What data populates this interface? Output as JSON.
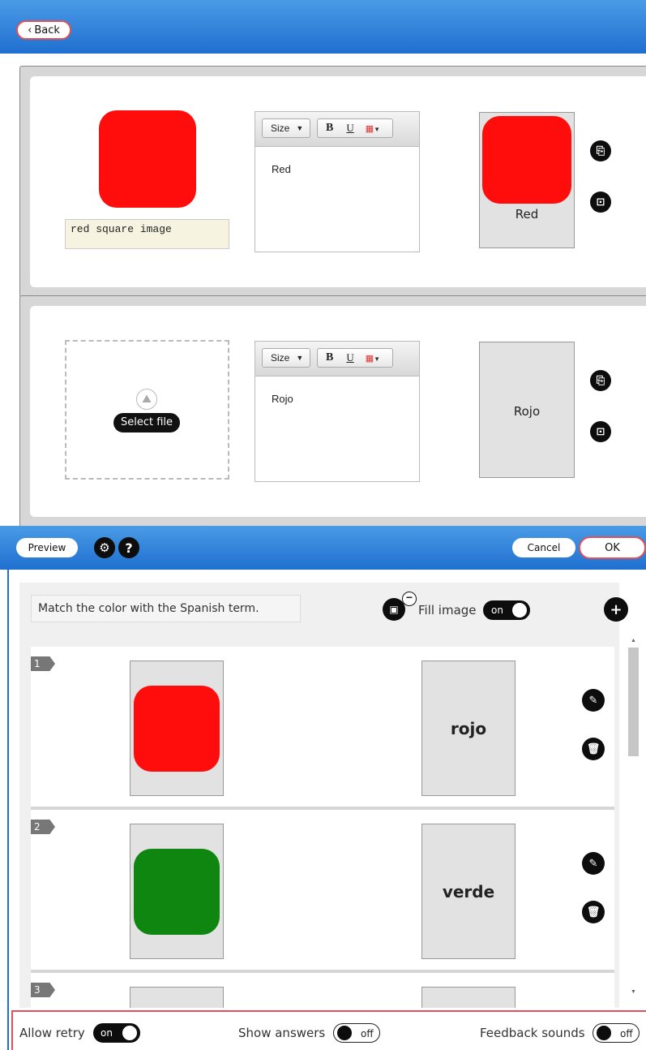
{
  "top": {
    "back_label": "Back"
  },
  "card1": {
    "alt_text": "red square image",
    "editor_text": "Red",
    "preview_label": "Red",
    "toolbar": {
      "size_label": "Size",
      "bold": "B",
      "underline": "U"
    }
  },
  "card2": {
    "select_file_label": "Select file",
    "editor_text": "Rojo",
    "preview_label": "Rojo",
    "toolbar": {
      "size_label": "Size",
      "bold": "B",
      "underline": "U"
    }
  },
  "toolbar": {
    "preview_label": "Preview",
    "help_symbol": "?",
    "cancel_label": "Cancel",
    "ok_label": "OK"
  },
  "instructions": "Match the color with the Spanish term.",
  "fill_image": {
    "label": "Fill image",
    "state": "on"
  },
  "items": [
    {
      "number": "1",
      "term": "rojo",
      "color": "#ff0d0d"
    },
    {
      "number": "2",
      "term": "verde",
      "color": "#0f860f"
    },
    {
      "number": "3",
      "term": "",
      "color": ""
    }
  ],
  "settings": {
    "allow_retry": {
      "label": "Allow retry",
      "state": "on"
    },
    "show_answers": {
      "label": "Show answers",
      "state": "off"
    },
    "feedback_sounds": {
      "label": "Feedback sounds",
      "state": "off"
    }
  },
  "colors": {
    "accent_blue": "#1f6fd0",
    "highlight_red": "#e0525a",
    "red": "#ff0d0d",
    "green": "#0f860f"
  }
}
